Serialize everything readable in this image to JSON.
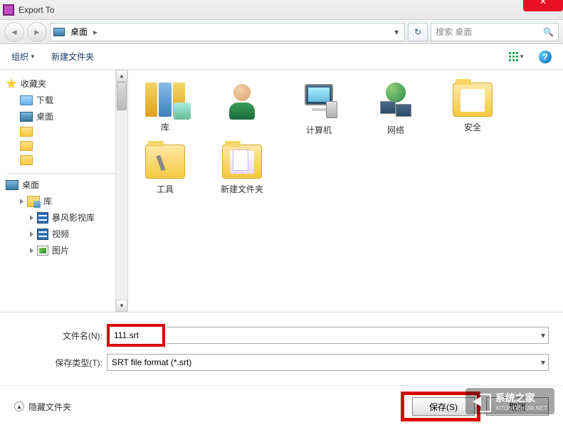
{
  "window": {
    "title": "Export To"
  },
  "nav": {
    "location_icon": "desktop",
    "crumb": "桌面",
    "search_placeholder": "搜索 桌面"
  },
  "toolbar": {
    "organize": "组织",
    "new_folder": "新建文件夹"
  },
  "sidebar": {
    "favorites": "收藏夹",
    "downloads": "下载",
    "desktop": "桌面",
    "desktop2": "桌面",
    "library": "库",
    "stormlib": "暴风影视库",
    "video": "视频",
    "pictures": "图片"
  },
  "items": {
    "library": "库",
    "computer": "计算机",
    "network": "网络",
    "security": "安全",
    "tools": "工具",
    "new_folder": "新建文件夹"
  },
  "form": {
    "filename_label": "文件名(N):",
    "filename_value": "111.srt",
    "type_label": "保存类型(T):",
    "type_value": "SRT file format (*.srt)"
  },
  "footer": {
    "hide_folders": "隐藏文件夹",
    "save": "保存(S)",
    "cancel": "取消"
  },
  "watermark": {
    "text": "系统之家",
    "sub": "XITONGZHIJIA.NET"
  }
}
